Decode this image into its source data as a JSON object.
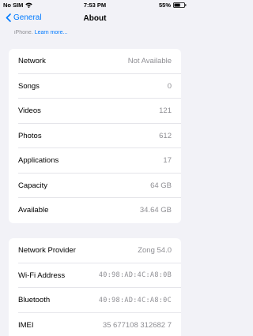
{
  "status_bar": {
    "carrier": "No SIM",
    "time": "7:53 PM",
    "battery": "55%"
  },
  "nav": {
    "back_label": "General",
    "title": "About"
  },
  "footnote": {
    "prefix": "iPhone.",
    "link": "Learn more..."
  },
  "group1": [
    {
      "label": "Network",
      "value": "Not Available"
    },
    {
      "label": "Songs",
      "value": "0"
    },
    {
      "label": "Videos",
      "value": "121"
    },
    {
      "label": "Photos",
      "value": "612"
    },
    {
      "label": "Applications",
      "value": "17"
    },
    {
      "label": "Capacity",
      "value": "64 GB"
    },
    {
      "label": "Available",
      "value": "34.64 GB"
    }
  ],
  "group2": [
    {
      "label": "Network Provider",
      "value": "Zong 54.0"
    },
    {
      "label": "Wi-Fi Address",
      "value": "40:98:AD:4C:A8:0B"
    },
    {
      "label": "Bluetooth",
      "value": "40:98:AD:4C:A8:0C"
    },
    {
      "label": "IMEI",
      "value": "35 677108 312682 7"
    }
  ]
}
